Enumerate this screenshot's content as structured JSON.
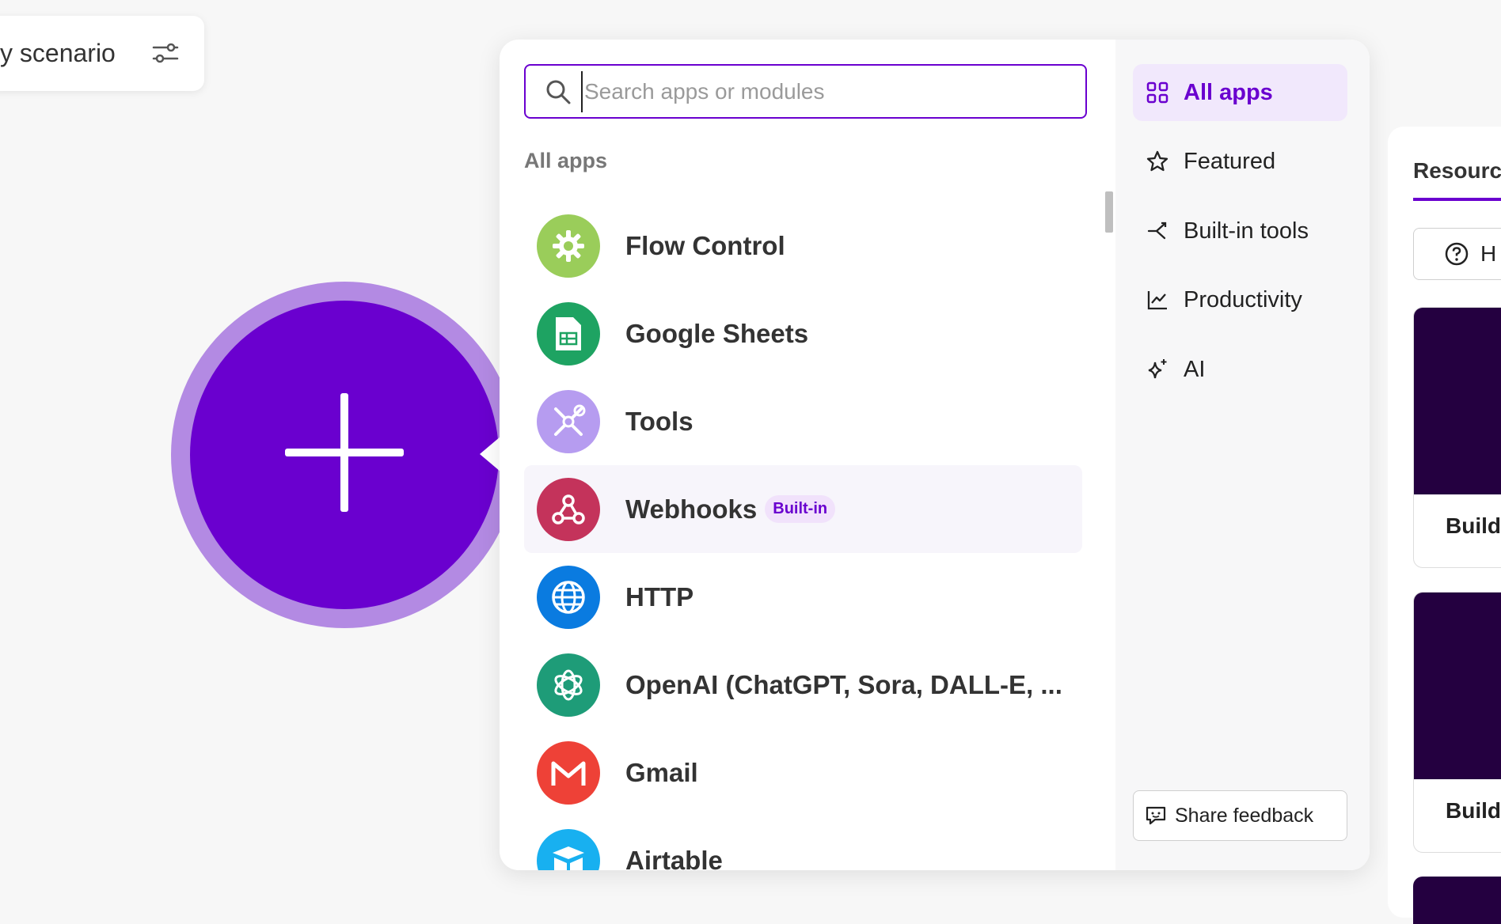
{
  "scenario": {
    "name": "y scenario"
  },
  "search": {
    "placeholder": "Search apps or modules",
    "value": ""
  },
  "list": {
    "section_label": "All apps",
    "apps": [
      {
        "name": "Flow Control",
        "icon": "gear-icon",
        "color": "#9acd5a"
      },
      {
        "name": "Google Sheets",
        "icon": "sheets-icon",
        "color": "#1ea362"
      },
      {
        "name": "Tools",
        "icon": "tools-icon",
        "color": "#b69cf0"
      },
      {
        "name": "Webhooks",
        "icon": "webhook-icon",
        "color": "#c4335b",
        "badge": "Built-in"
      },
      {
        "name": "HTTP",
        "icon": "globe-icon",
        "color": "#0a7be0"
      },
      {
        "name": "OpenAI (ChatGPT, Sora, DALL-E, ...",
        "icon": "openai-icon",
        "color": "#1e9c78"
      },
      {
        "name": "Gmail",
        "icon": "gmail-icon",
        "color": "#ee4137"
      },
      {
        "name": "Airtable",
        "icon": "airtable-icon",
        "color": "#18b0f0"
      }
    ]
  },
  "categories": [
    {
      "label": "All apps",
      "icon": "grid-icon",
      "active": true
    },
    {
      "label": "Featured",
      "icon": "star-icon"
    },
    {
      "label": "Built-in tools",
      "icon": "branch-icon"
    },
    {
      "label": "Productivity",
      "icon": "chart-icon"
    },
    {
      "label": "AI",
      "icon": "sparkle-icon"
    }
  ],
  "feedback": {
    "label": "Share feedback"
  },
  "resources": {
    "tab_label": "Resourc",
    "help_label": "H",
    "card1_title": "Build",
    "card2_title": "Build"
  },
  "colors": {
    "accent": "#6a00cf",
    "accent_light": "#b38ae3"
  }
}
